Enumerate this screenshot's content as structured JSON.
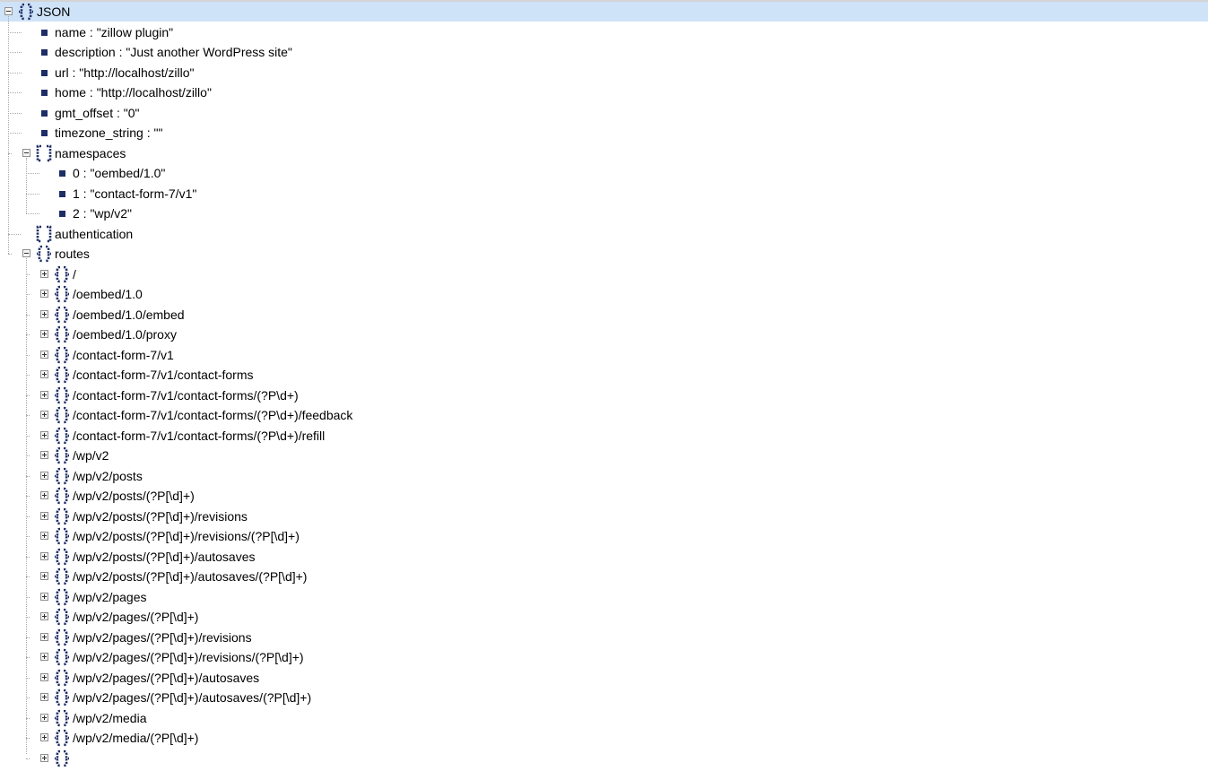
{
  "tree": [
    {
      "label": "JSON",
      "icon": "object-braces-icon",
      "toggle": "collapse",
      "level": 0,
      "selected": true
    },
    {
      "label": "name : \"zillow plugin\"",
      "icon": "value-bullet-icon",
      "level": 1
    },
    {
      "label": "description : \"Just another WordPress site\"",
      "icon": "value-bullet-icon",
      "level": 1
    },
    {
      "label": "url : \"http://localhost/zillo\"",
      "icon": "value-bullet-icon",
      "level": 1
    },
    {
      "label": "home : \"http://localhost/zillo\"",
      "icon": "value-bullet-icon",
      "level": 1
    },
    {
      "label": "gmt_offset : \"0\"",
      "icon": "value-bullet-icon",
      "level": 1
    },
    {
      "label": "timezone_string : \"\"",
      "icon": "value-bullet-icon",
      "level": 1
    },
    {
      "label": "namespaces",
      "icon": "array-brackets-icon",
      "toggle": "collapse",
      "level": 1
    },
    {
      "label": "0 : \"oembed/1.0\"",
      "icon": "value-bullet-icon",
      "level": 2
    },
    {
      "label": "1 : \"contact-form-7/v1\"",
      "icon": "value-bullet-icon",
      "level": 2
    },
    {
      "label": "2 : \"wp/v2\"",
      "icon": "value-bullet-icon",
      "level": 2
    },
    {
      "label": "authentication",
      "icon": "array-brackets-icon",
      "level": 1
    },
    {
      "label": "routes",
      "icon": "object-braces-icon",
      "toggle": "collapse",
      "level": 1
    },
    {
      "label": "/",
      "icon": "object-braces-icon",
      "toggle": "expand",
      "level": 2
    },
    {
      "label": "/oembed/1.0",
      "icon": "object-braces-icon",
      "toggle": "expand",
      "level": 2
    },
    {
      "label": "/oembed/1.0/embed",
      "icon": "object-braces-icon",
      "toggle": "expand",
      "level": 2
    },
    {
      "label": "/oembed/1.0/proxy",
      "icon": "object-braces-icon",
      "toggle": "expand",
      "level": 2
    },
    {
      "label": "/contact-form-7/v1",
      "icon": "object-braces-icon",
      "toggle": "expand",
      "level": 2
    },
    {
      "label": "/contact-form-7/v1/contact-forms",
      "icon": "object-braces-icon",
      "toggle": "expand",
      "level": 2
    },
    {
      "label": "/contact-form-7/v1/contact-forms/(?P\\d+)",
      "icon": "object-braces-icon",
      "toggle": "expand",
      "level": 2
    },
    {
      "label": "/contact-form-7/v1/contact-forms/(?P\\d+)/feedback",
      "icon": "object-braces-icon",
      "toggle": "expand",
      "level": 2
    },
    {
      "label": "/contact-form-7/v1/contact-forms/(?P\\d+)/refill",
      "icon": "object-braces-icon",
      "toggle": "expand",
      "level": 2
    },
    {
      "label": "/wp/v2",
      "icon": "object-braces-icon",
      "toggle": "expand",
      "level": 2
    },
    {
      "label": "/wp/v2/posts",
      "icon": "object-braces-icon",
      "toggle": "expand",
      "level": 2
    },
    {
      "label": "/wp/v2/posts/(?P[\\d]+)",
      "icon": "object-braces-icon",
      "toggle": "expand",
      "level": 2
    },
    {
      "label": "/wp/v2/posts/(?P[\\d]+)/revisions",
      "icon": "object-braces-icon",
      "toggle": "expand",
      "level": 2
    },
    {
      "label": "/wp/v2/posts/(?P[\\d]+)/revisions/(?P[\\d]+)",
      "icon": "object-braces-icon",
      "toggle": "expand",
      "level": 2
    },
    {
      "label": "/wp/v2/posts/(?P[\\d]+)/autosaves",
      "icon": "object-braces-icon",
      "toggle": "expand",
      "level": 2
    },
    {
      "label": "/wp/v2/posts/(?P[\\d]+)/autosaves/(?P[\\d]+)",
      "icon": "object-braces-icon",
      "toggle": "expand",
      "level": 2
    },
    {
      "label": "/wp/v2/pages",
      "icon": "object-braces-icon",
      "toggle": "expand",
      "level": 2
    },
    {
      "label": "/wp/v2/pages/(?P[\\d]+)",
      "icon": "object-braces-icon",
      "toggle": "expand",
      "level": 2
    },
    {
      "label": "/wp/v2/pages/(?P[\\d]+)/revisions",
      "icon": "object-braces-icon",
      "toggle": "expand",
      "level": 2
    },
    {
      "label": "/wp/v2/pages/(?P[\\d]+)/revisions/(?P[\\d]+)",
      "icon": "object-braces-icon",
      "toggle": "expand",
      "level": 2
    },
    {
      "label": "/wp/v2/pages/(?P[\\d]+)/autosaves",
      "icon": "object-braces-icon",
      "toggle": "expand",
      "level": 2
    },
    {
      "label": "/wp/v2/pages/(?P[\\d]+)/autosaves/(?P[\\d]+)",
      "icon": "object-braces-icon",
      "toggle": "expand",
      "level": 2
    },
    {
      "label": "/wp/v2/media",
      "icon": "object-braces-icon",
      "toggle": "expand",
      "level": 2
    },
    {
      "label": "/wp/v2/media/(?P[\\d]+)",
      "icon": "object-braces-icon",
      "toggle": "expand",
      "level": 2
    },
    {
      "label": "",
      "icon": "object-braces-icon",
      "toggle": "expand",
      "level": 2
    }
  ],
  "colors": {
    "selection": "#cfe3f8",
    "icon": "#1d2d66",
    "guide": "#a9a9a9"
  }
}
